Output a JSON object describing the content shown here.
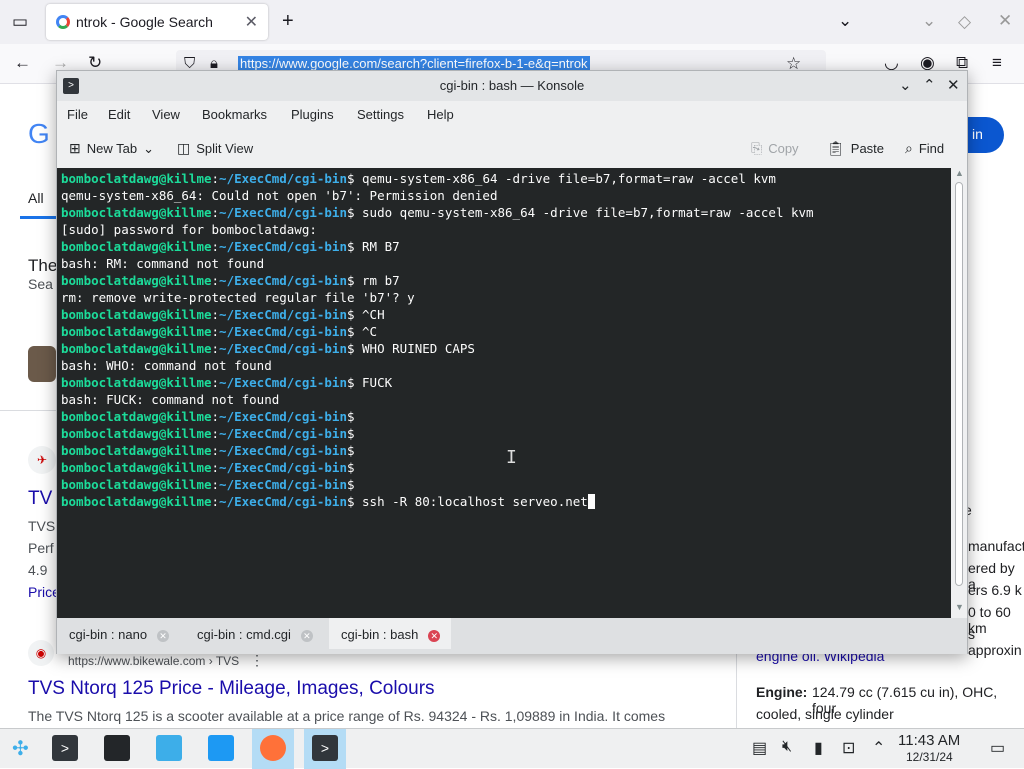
{
  "browser": {
    "tab_title": "ntrok - Google Search",
    "url": "https://www.google.com/search?client=firefox-b-1-e&q=ntrok",
    "page": {
      "logo_letter": "G",
      "signin_label": "in",
      "all_tab": "All",
      "result_the": "The",
      "result_sea": "Sea",
      "tvs_short": "TV",
      "tvs_line1": "TVS",
      "tvs_line2": "Perf",
      "tvs_rating": "4.9",
      "tvs_price": "Price",
      "result_url": "https://www.bikewale.com › TVS",
      "result_title": "TVS Ntorq 125 Price - Mileage, Images, Colours",
      "result_snippet": "The TVS Ntorq 125 is a scooter available at a price range of Rs. 94324 - Rs. 1,09889 in India. It comes",
      "side_e": "e",
      "side_manufact": "manufact",
      "side_red": "ered by a",
      "side_ers": "ers 6.9 k",
      "side_to60": "0 to 60 km",
      "side_approx": "s approxin",
      "side_wiki": "engine oil. Wikipedia",
      "side_engine_label": "Engine:",
      "side_engine_value": "124.79 cc (7.615 cu in), OHC, four",
      "side_engine_value2": "cooled, single cylinder"
    }
  },
  "konsole": {
    "window_title": "cgi-bin : bash — Konsole",
    "menu": [
      "File",
      "Edit",
      "View",
      "Bookmarks",
      "Plugins",
      "Settings",
      "Help"
    ],
    "toolbar": {
      "new_tab": "New Tab",
      "split_view": "Split View",
      "copy": "Copy",
      "paste": "Paste",
      "find": "Find"
    },
    "prompt_user": "bomboclatdawg@killme",
    "prompt_path": "~/ExecCmd/cgi-bin",
    "lines": [
      {
        "prompt": true,
        "cmd": " qemu-system-x86_64 -drive file=b7,format=raw -accel kvm"
      },
      {
        "prompt": false,
        "text": "qemu-system-x86_64: Could not open 'b7': Permission denied"
      },
      {
        "prompt": true,
        "cmd": " sudo qemu-system-x86_64 -drive file=b7,format=raw -accel kvm"
      },
      {
        "prompt": false,
        "text": "[sudo] password for bomboclatdawg:"
      },
      {
        "prompt": true,
        "cmd": " RM B7"
      },
      {
        "prompt": false,
        "text": "bash: RM: command not found"
      },
      {
        "prompt": true,
        "cmd": " rm b7"
      },
      {
        "prompt": false,
        "text": "rm: remove write-protected regular file 'b7'? y"
      },
      {
        "prompt": true,
        "cmd": " ^CH"
      },
      {
        "prompt": true,
        "cmd": " ^C"
      },
      {
        "prompt": true,
        "cmd": " WHO RUINED CAPS"
      },
      {
        "prompt": false,
        "text": "bash: WHO: command not found"
      },
      {
        "prompt": true,
        "cmd": " FUCK"
      },
      {
        "prompt": false,
        "text": "bash: FUCK: command not found"
      },
      {
        "prompt": true,
        "cmd": ""
      },
      {
        "prompt": true,
        "cmd": ""
      },
      {
        "prompt": true,
        "cmd": ""
      },
      {
        "prompt": true,
        "cmd": ""
      },
      {
        "prompt": true,
        "cmd": ""
      },
      {
        "prompt": true,
        "cmd": " ssh -R 80:localhost serveo.net",
        "cursor": true
      }
    ],
    "tabs": [
      {
        "label": "cgi-bin : nano",
        "active": false
      },
      {
        "label": "cgi-bin : cmd.cgi",
        "active": false
      },
      {
        "label": "cgi-bin : bash",
        "active": true
      }
    ]
  },
  "taskbar": {
    "time": "11:43 AM",
    "date": "12/31/24"
  }
}
